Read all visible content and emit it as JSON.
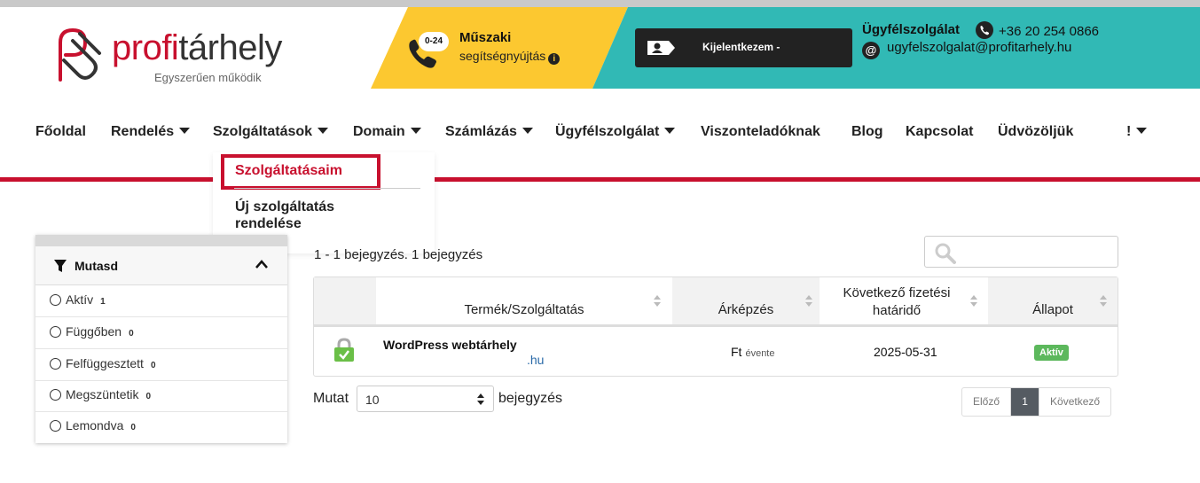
{
  "header": {
    "logo_word_a": "profi",
    "logo_word_b": "tárhely",
    "logo_tagline": "Egyszerűen működik",
    "tech_badge": "0-24",
    "tech_title": "Műszaki",
    "tech_subtitle": "segítségnyújtás",
    "logout_label": "Kijelentkezem - ",
    "support_title": "Ügyfélszolgálat",
    "support_phone": "+36 20 254 0866",
    "support_email": "ugyfelszolgalat@profitarhely.hu",
    "colors": {
      "yellow": "#fcc830",
      "teal": "#31b9b5",
      "brand_red": "#c8102e"
    }
  },
  "nav": {
    "items": [
      {
        "label": "Főoldal"
      },
      {
        "label": "Rendelés"
      },
      {
        "label": "Szolgáltatások"
      },
      {
        "label": "Domain"
      },
      {
        "label": "Számlázás"
      },
      {
        "label": "Ügyfélszolgálat"
      },
      {
        "label": "Viszonteladóknak"
      },
      {
        "label": "Blog"
      },
      {
        "label": "Kapcsolat"
      },
      {
        "label": "Üdvözöljük"
      },
      {
        "label": "!"
      }
    ],
    "dropdown": {
      "items": [
        {
          "label": "Szolgáltatásaim"
        },
        {
          "label": "Új szolgáltatás rendelése"
        }
      ]
    }
  },
  "filter": {
    "title": "Mutasd",
    "options": [
      {
        "label": "Aktív",
        "count": "1"
      },
      {
        "label": "Függőben",
        "count": "0"
      },
      {
        "label": "Felfüggesztett",
        "count": "0"
      },
      {
        "label": "Megszüntetik",
        "count": "0"
      },
      {
        "label": "Lemondva",
        "count": "0"
      }
    ]
  },
  "table": {
    "records_text": "1 - 1 bejegyzés. 1 bejegyzés",
    "search_placeholder": "",
    "columns": [
      "Termék/Szolgáltatás",
      "Árképzés",
      "Következő fizetési határidő",
      "Állapot"
    ],
    "rows": [
      {
        "product": "WordPress webtárhely",
        "domain": ".hu",
        "price": "Ft",
        "cycle": "évente",
        "due": "2025-05-31",
        "status": "Aktív"
      }
    ]
  },
  "footer": {
    "show_label": "Mutat",
    "page_size": "10",
    "entries_label": "bejegyzés",
    "prev_label": "Előző",
    "current_page": "1",
    "next_label": "Következő"
  }
}
